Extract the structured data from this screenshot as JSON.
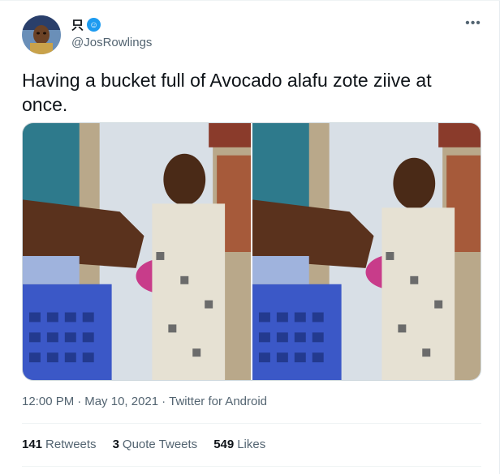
{
  "user": {
    "display_name": "只",
    "name_emoji": "☺",
    "handle": "@JosRowlings"
  },
  "tweet": {
    "text": "Having a bucket full of Avocado alafu zote ziive at once."
  },
  "more_icon": "more-icon",
  "meta": {
    "time": "12:00 PM",
    "separator1": "·",
    "date": "May 10, 2021",
    "separator2": "·",
    "source": "Twitter for Android"
  },
  "stats": {
    "retweets_count": "141",
    "retweets_label": "Retweets",
    "quotes_count": "3",
    "quotes_label": "Quote Tweets",
    "likes_count": "549",
    "likes_label": "Likes"
  },
  "colors": {
    "text_primary": "#0f1419",
    "text_secondary": "#536471",
    "divider": "#eff3f4",
    "accent": "#1d9bf0"
  }
}
